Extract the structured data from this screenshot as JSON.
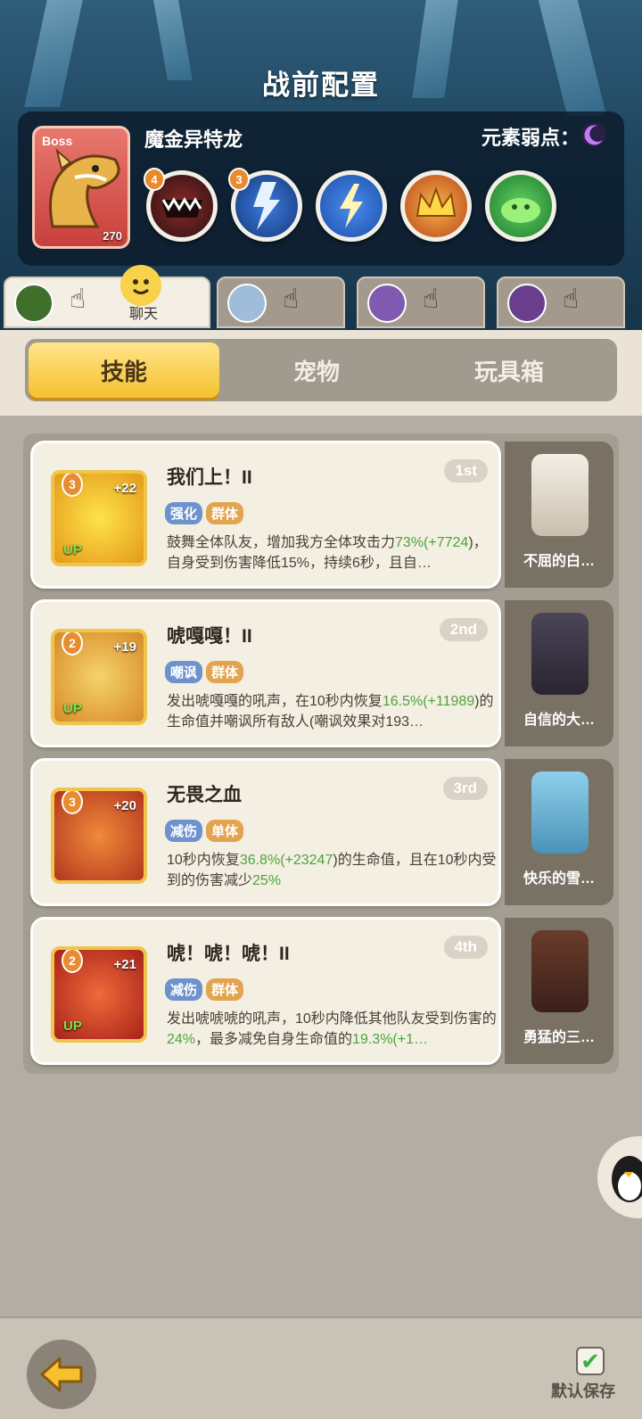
{
  "header": {
    "title": "战前配置"
  },
  "boss": {
    "tag": "Boss",
    "name": "魔金异特龙",
    "level": "270",
    "weakness_label": "元素弱点：",
    "weakness_icon": "moon-icon",
    "skills": [
      {
        "icon": "fanged-mouth-icon",
        "badge": "4"
      },
      {
        "icon": "lightning-strike-icon",
        "badge": "3"
      },
      {
        "icon": "lightning-bolt-icon",
        "badge": ""
      },
      {
        "icon": "golden-crown-icon",
        "badge": ""
      },
      {
        "icon": "green-slime-icon",
        "badge": ""
      }
    ]
  },
  "chat": {
    "label": "聊天"
  },
  "main_tabs": [
    {
      "label": "技能",
      "active": true
    },
    {
      "label": "宠物",
      "active": false
    },
    {
      "label": "玩具箱",
      "active": false
    }
  ],
  "skills": [
    {
      "title": "我们上！II",
      "rank": "1st",
      "level": "3",
      "plus": "+22",
      "up": "UP",
      "tags": [
        "强化",
        "群体"
      ],
      "desc_parts": [
        "鼓舞全体队友，增加我方全体攻击力",
        "73%",
        "(+7724",
        ")，自身受到伤害降低15%，持续6秒，且自…"
      ],
      "pet_name": "不屈的白…"
    },
    {
      "title": "唬嘎嘎！II",
      "rank": "2nd",
      "level": "2",
      "plus": "+19",
      "up": "UP",
      "tags": [
        "嘲讽",
        "群体"
      ],
      "desc_parts": [
        "发出唬嘎嘎的吼声，在10秒内恢复",
        "16.5%",
        "(+11989",
        ")的生命值并嘲讽所有敌人(嘲讽效果对193…"
      ],
      "pet_name": "自信的大…"
    },
    {
      "title": "无畏之血",
      "rank": "3rd",
      "level": "3",
      "plus": "+20",
      "up": "",
      "tags": [
        "减伤",
        "单体"
      ],
      "desc_parts": [
        "10秒内恢复",
        "36.8%",
        "(+23247",
        ")的生命值，且在10秒内受到的伤害减少",
        "25%"
      ],
      "pet_name": "快乐的雪…"
    },
    {
      "title": "唬！唬！唬！II",
      "rank": "4th",
      "level": "2",
      "plus": "+21",
      "up": "UP",
      "tags": [
        "减伤",
        "群体"
      ],
      "desc_parts": [
        "发出唬唬唬的吼声，10秒内降低其他队友受到伤害的",
        "24%",
        "，最多减免自身生命值的",
        "19.3%",
        "(+1…"
      ],
      "pet_name": "勇猛的三…"
    }
  ],
  "footer": {
    "save_label": "默认保存",
    "save_checked": true
  }
}
